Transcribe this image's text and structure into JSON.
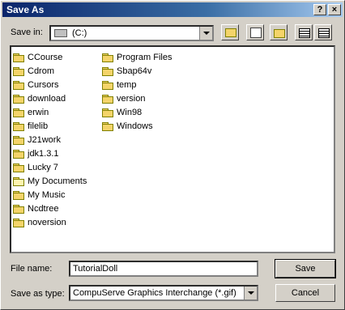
{
  "window": {
    "title": "Save As",
    "help_button": "?",
    "close_button": "×"
  },
  "save_in": {
    "label": "Save in:",
    "value": "(C:)"
  },
  "toolbar": {
    "icons": [
      "up-folder-icon",
      "desktop-icon",
      "new-folder-icon",
      "list-view-icon",
      "details-view-icon"
    ]
  },
  "files": {
    "column1": [
      "CCourse",
      "Cdrom",
      "Cursors",
      "download",
      "erwin",
      "filelib",
      "J21work",
      "jdk1.3.1",
      "Lucky 7",
      "My Documents",
      "My Music",
      "Ncdtree",
      "noversion"
    ],
    "column2": [
      "Program Files",
      "Sbap64v",
      "temp",
      "version",
      "Win98",
      "Windows"
    ]
  },
  "file_name": {
    "label": "File name:",
    "value": "TutorialDoll"
  },
  "save_as_type": {
    "label": "Save as type:",
    "value": "CompuServe Graphics Interchange (*.gif)"
  },
  "buttons": {
    "save": "Save",
    "cancel": "Cancel"
  }
}
